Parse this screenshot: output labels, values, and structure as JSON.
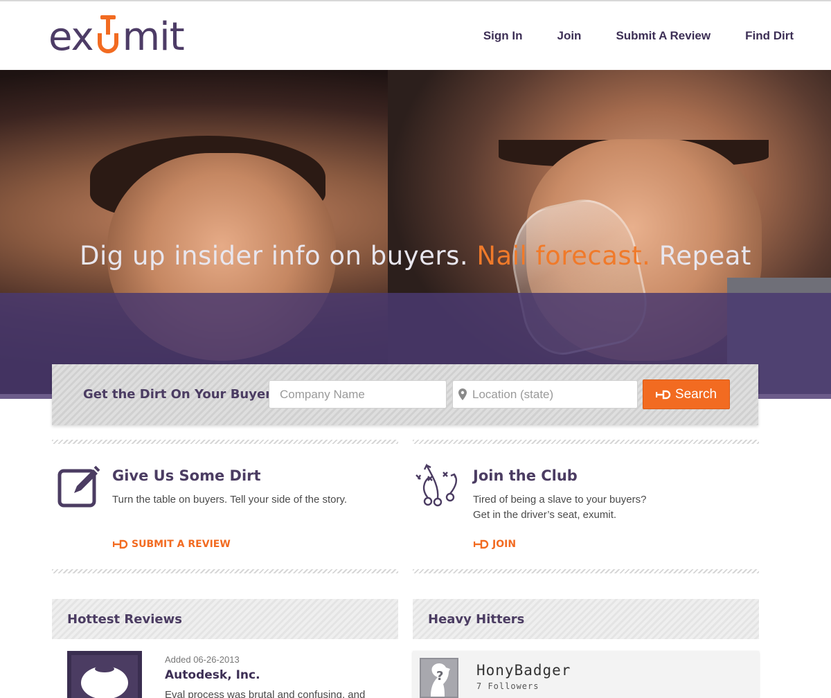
{
  "brand": {
    "logo_left": "ex",
    "logo_right": "mit",
    "accent": "#f26b21",
    "primary": "#4b3c62"
  },
  "nav": {
    "sign_in": "Sign In",
    "join": "Join",
    "submit_review": "Submit A Review",
    "find_dirt": "Find Dirt"
  },
  "hero": {
    "tagline_part1": "Dig up insider info on buyers.",
    "tagline_accent": "Nail forecast.",
    "tagline_part3": "Repeat"
  },
  "search": {
    "label": "Get the Dirt On Your Buyers",
    "company_placeholder": "Company Name",
    "location_placeholder": "Location (state)",
    "button_label": "Search"
  },
  "promos": {
    "give": {
      "title": "Give Us Some Dirt",
      "text": "Turn the table on buyers. Tell your side of the story.",
      "link": "SUBMIT A REVIEW",
      "icon": "edit-icon"
    },
    "club": {
      "title": "Join the Club",
      "line1": "Tired of being a slave to your buyers?",
      "line2": "Get in the driver’s seat, exumit.",
      "link": "JOIN",
      "icon": "playbook-icon"
    }
  },
  "sections": {
    "hottest": "Hottest Reviews",
    "hitters": "Heavy Hitters"
  },
  "reviews": [
    {
      "date": "Added 06-26-2013",
      "company": "Autodesk, Inc.",
      "snippet": "Eval process was brutal and confusing, and"
    }
  ],
  "hitters": [
    {
      "name": "HonyBadger",
      "followers": "7 Followers"
    }
  ]
}
